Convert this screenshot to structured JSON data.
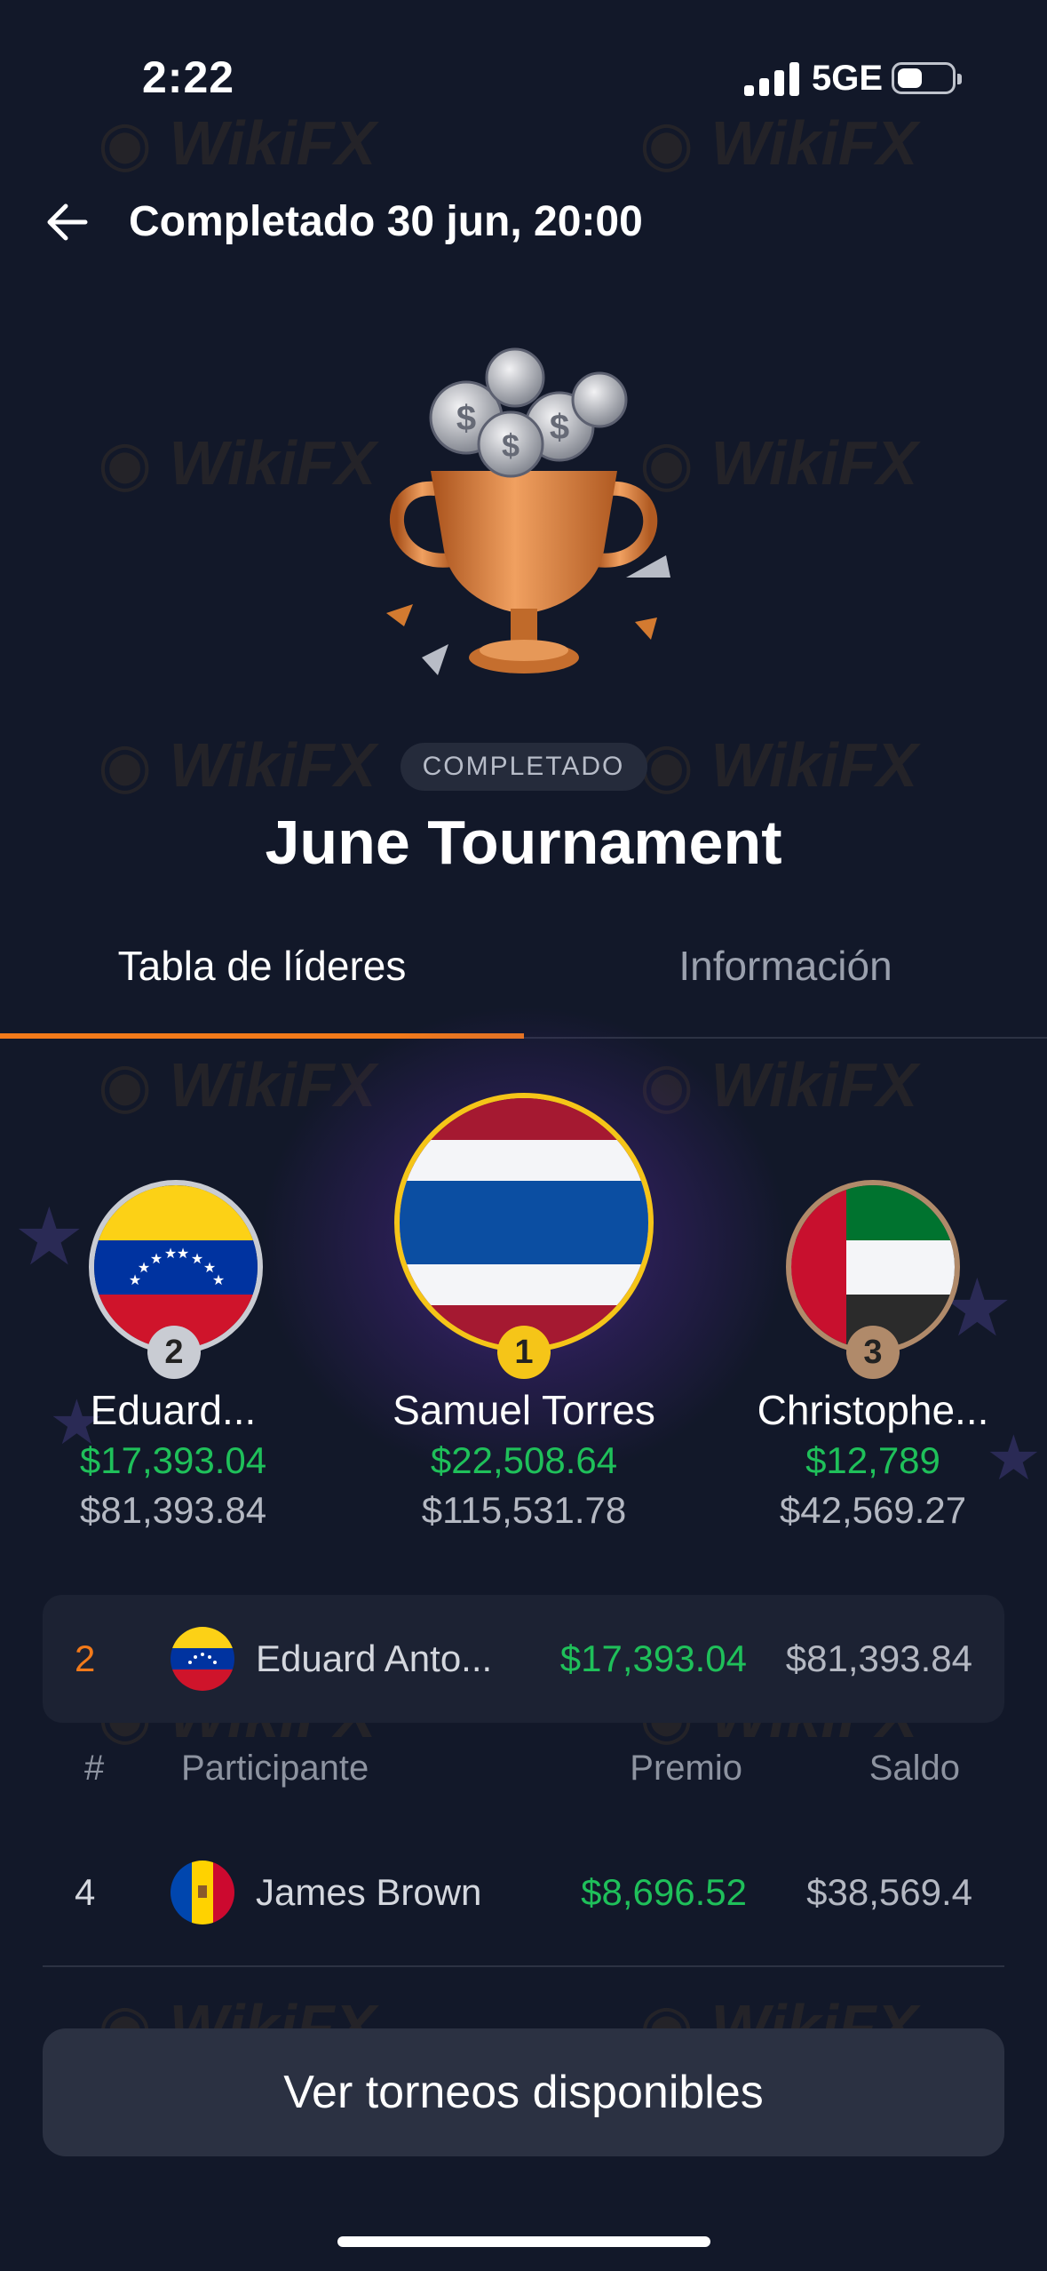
{
  "status_bar": {
    "time": "2:22",
    "network": "5GE",
    "battery_level": 0.45
  },
  "header": {
    "title": "Completado 30 jun, 20:00"
  },
  "tournament": {
    "status": "COMPLETADO",
    "name": "June Tournament"
  },
  "tabs": [
    {
      "label": "Tabla de líderes",
      "active": true
    },
    {
      "label": "Información",
      "active": false
    }
  ],
  "podium": {
    "first": {
      "rank": "1",
      "name": "Samuel Torres",
      "prize": "$22,508.64",
      "balance": "$115,531.78",
      "flag": "thailand"
    },
    "second": {
      "rank": "2",
      "name": "Eduard...",
      "prize": "$17,393.04",
      "balance": "$81,393.84",
      "flag": "venezuela"
    },
    "third": {
      "rank": "3",
      "name": "Christophe...",
      "prize": "$12,789",
      "balance": "$42,569.27",
      "flag": "uae"
    }
  },
  "my_row": {
    "rank": "2",
    "name": "Eduard Anto...",
    "prize": "$17,393.04",
    "balance": "$81,393.84",
    "flag": "venezuela"
  },
  "table": {
    "headers": {
      "rank": "#",
      "participant": "Participante",
      "prize": "Premio",
      "balance": "Saldo"
    },
    "rows": [
      {
        "rank": "4",
        "name": "James Brown",
        "prize": "$8,696.52",
        "balance": "$38,569.4",
        "flag": "moldova"
      }
    ]
  },
  "cta": {
    "label": "Ver torneos disponibles"
  },
  "colors": {
    "background": "#121829",
    "accent": "#f27a1a",
    "prize_green": "#1fc05a",
    "gold": "#f5c518",
    "silver": "#c9ccd3",
    "bronze": "#b08a6a"
  }
}
